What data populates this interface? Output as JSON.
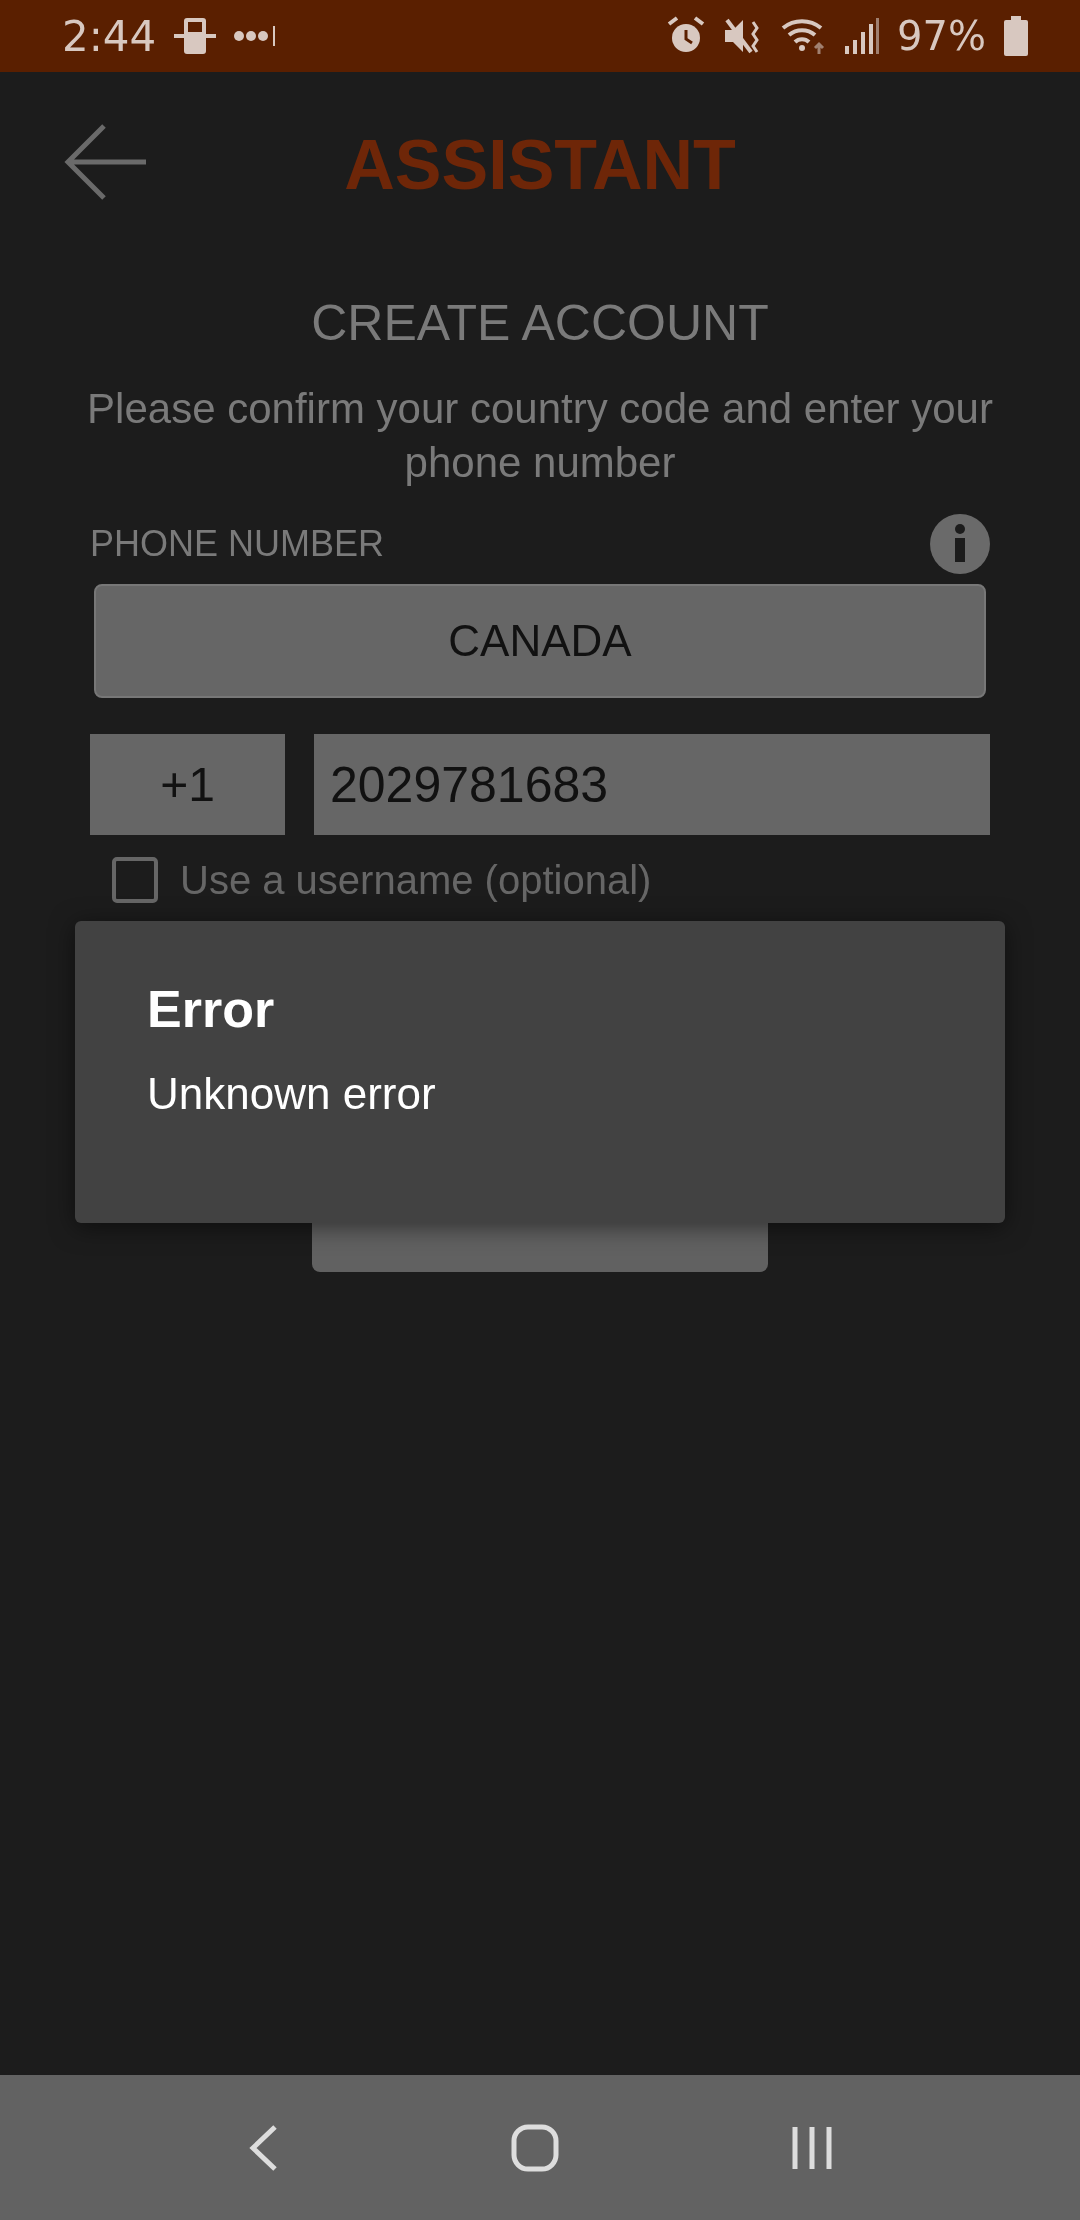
{
  "status_bar": {
    "time": "2:44",
    "battery": "97%"
  },
  "header": {
    "title": "ASSISTANT"
  },
  "heading": "CREATE ACCOUNT",
  "instructions": "Please confirm your country code and enter your phone number",
  "phone_label": "PHONE NUMBER",
  "country": "CANADA",
  "country_code": "+1",
  "phone": {
    "value": "2029781683"
  },
  "username_option": {
    "label": "Use a username (optional)",
    "checked": false
  },
  "dialog": {
    "title": "Error",
    "message": "Unknown error"
  }
}
